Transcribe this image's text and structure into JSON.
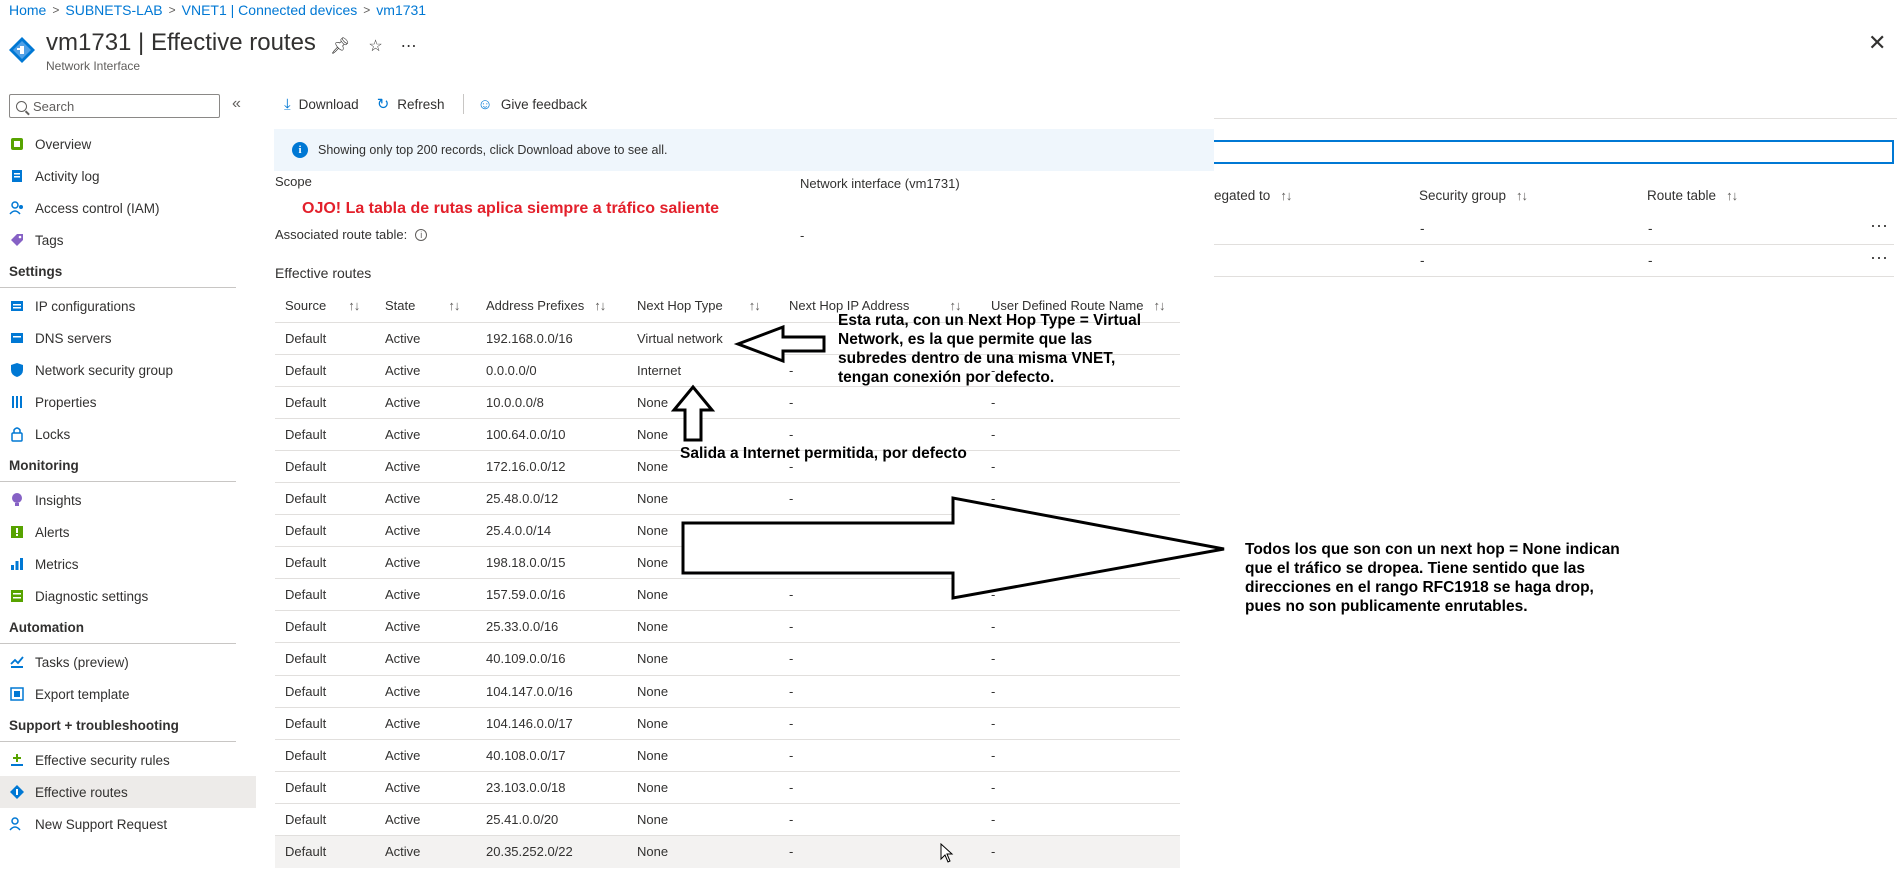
{
  "breadcrumb": [
    "Home",
    "SUBNETS-LAB",
    "VNET1 | Connected devices",
    "vm1731"
  ],
  "title": {
    "main": "vm1731 | Effective routes",
    "subtitle": "Network Interface",
    "actions": [
      "pin-icon",
      "star-icon",
      "more-icon"
    ]
  },
  "sidebar": {
    "search_placeholder": "Search",
    "collapse_label": "«",
    "groups": [
      {
        "items": [
          {
            "label": "Overview",
            "icon": "overview-icon",
            "color": "#57a300"
          },
          {
            "label": "Activity log",
            "icon": "activity-log-icon",
            "color": "#0078d4"
          },
          {
            "label": "Access control (IAM)",
            "icon": "iam-icon",
            "color": "#0078d4"
          },
          {
            "label": "Tags",
            "icon": "tag-icon",
            "color": "#8661c5"
          }
        ]
      },
      {
        "section": "Settings",
        "items": [
          {
            "label": "IP configurations",
            "icon": "ip-config-icon",
            "color": "#0078d4"
          },
          {
            "label": "DNS servers",
            "icon": "dns-icon",
            "color": "#0078d4"
          },
          {
            "label": "Network security group",
            "icon": "nsg-icon",
            "color": "#0078d4"
          },
          {
            "label": "Properties",
            "icon": "properties-icon",
            "color": "#0078d4"
          },
          {
            "label": "Locks",
            "icon": "lock-icon",
            "color": "#0078d4"
          }
        ]
      },
      {
        "section": "Monitoring",
        "items": [
          {
            "label": "Insights",
            "icon": "insights-icon",
            "color": "#8661c5"
          },
          {
            "label": "Alerts",
            "icon": "alerts-icon",
            "color": "#57a300"
          },
          {
            "label": "Metrics",
            "icon": "metrics-icon",
            "color": "#0078d4"
          },
          {
            "label": "Diagnostic settings",
            "icon": "diagnostic-icon",
            "color": "#57a300"
          }
        ]
      },
      {
        "section": "Automation",
        "items": [
          {
            "label": "Tasks (preview)",
            "icon": "tasks-icon",
            "color": "#0078d4"
          },
          {
            "label": "Export template",
            "icon": "export-template-icon",
            "color": "#0078d4"
          }
        ]
      },
      {
        "section": "Support + troubleshooting",
        "items": [
          {
            "label": "Effective security rules",
            "icon": "security-rules-icon",
            "color": "#0078d4"
          },
          {
            "label": "Effective routes",
            "icon": "routes-icon",
            "color": "#0078d4",
            "selected": true
          },
          {
            "label": "New Support Request",
            "icon": "support-icon",
            "color": "#0078d4"
          }
        ]
      }
    ]
  },
  "toolbar": {
    "download": "Download",
    "refresh": "Refresh",
    "feedback": "Give feedback"
  },
  "banner": {
    "text": "Showing only top 200 records, click Download above to see all."
  },
  "scope": {
    "label": "Scope",
    "value": "Network interface (vm1731)",
    "assoc_label": "Associated route table:",
    "assoc_value": "-"
  },
  "effective_routes_title": "Effective routes",
  "table": {
    "columns": [
      "Source",
      "State",
      "Address Prefixes",
      "Next Hop Type",
      "Next Hop IP Address",
      "User Defined Route Name"
    ],
    "rows": [
      [
        "Default",
        "Active",
        "192.168.0.0/16",
        "Virtual network",
        "-",
        "-"
      ],
      [
        "Default",
        "Active",
        "0.0.0.0/0",
        "Internet",
        "-",
        "-"
      ],
      [
        "Default",
        "Active",
        "10.0.0.0/8",
        "None",
        "-",
        "-"
      ],
      [
        "Default",
        "Active",
        "100.64.0.0/10",
        "None",
        "-",
        "-"
      ],
      [
        "Default",
        "Active",
        "172.16.0.0/12",
        "None",
        "-",
        "-"
      ],
      [
        "Default",
        "Active",
        "25.48.0.0/12",
        "None",
        "-",
        "-"
      ],
      [
        "Default",
        "Active",
        "25.4.0.0/14",
        "None",
        "-",
        "-"
      ],
      [
        "Default",
        "Active",
        "198.18.0.0/15",
        "None",
        "-",
        "-"
      ],
      [
        "Default",
        "Active",
        "157.59.0.0/16",
        "None",
        "-",
        "-"
      ],
      [
        "Default",
        "Active",
        "25.33.0.0/16",
        "None",
        "-",
        "-"
      ],
      [
        "Default",
        "Active",
        "40.109.0.0/16",
        "None",
        "-",
        "-"
      ],
      [
        "Default",
        "Active",
        "104.147.0.0/16",
        "None",
        "-",
        "-"
      ],
      [
        "Default",
        "Active",
        "104.146.0.0/17",
        "None",
        "-",
        "-"
      ],
      [
        "Default",
        "Active",
        "40.108.0.0/17",
        "None",
        "-",
        "-"
      ],
      [
        "Default",
        "Active",
        "23.103.0.0/18",
        "None",
        "-",
        "-"
      ],
      [
        "Default",
        "Active",
        "25.41.0.0/20",
        "None",
        "-",
        "-"
      ],
      [
        "Default",
        "Active",
        "20.35.252.0/22",
        "None",
        "-",
        "-"
      ]
    ]
  },
  "background_blade": {
    "columns": [
      "egated to",
      "Security group",
      "Route table"
    ],
    "rows": [
      [
        "-",
        "-"
      ],
      [
        "-",
        "-"
      ]
    ],
    "more": "···"
  },
  "annotations": {
    "ojo": "OJO! La tabla de rutas aplica siempre a tráfico saliente",
    "vnet": [
      "Esta ruta, con un Next Hop Type = Virtual",
      "Network, es la que permite que las",
      "subredes dentro de una misma VNET,",
      "tengan conexión por defecto."
    ],
    "internet": "Salida a Internet permitida, por defecto",
    "none": [
      "Todos los que son con un next hop = None indican",
      "que el tráfico se dropea. Tiene sentido que las",
      "direcciones en el rango RFC1918 se haga drop,",
      "pues no son publicamente enrutables."
    ]
  },
  "colors": {
    "accent": "#0078d4",
    "annotation_red": "#e3202b",
    "banner_bg": "#eff6fc",
    "selected_bg": "#edebe9"
  }
}
